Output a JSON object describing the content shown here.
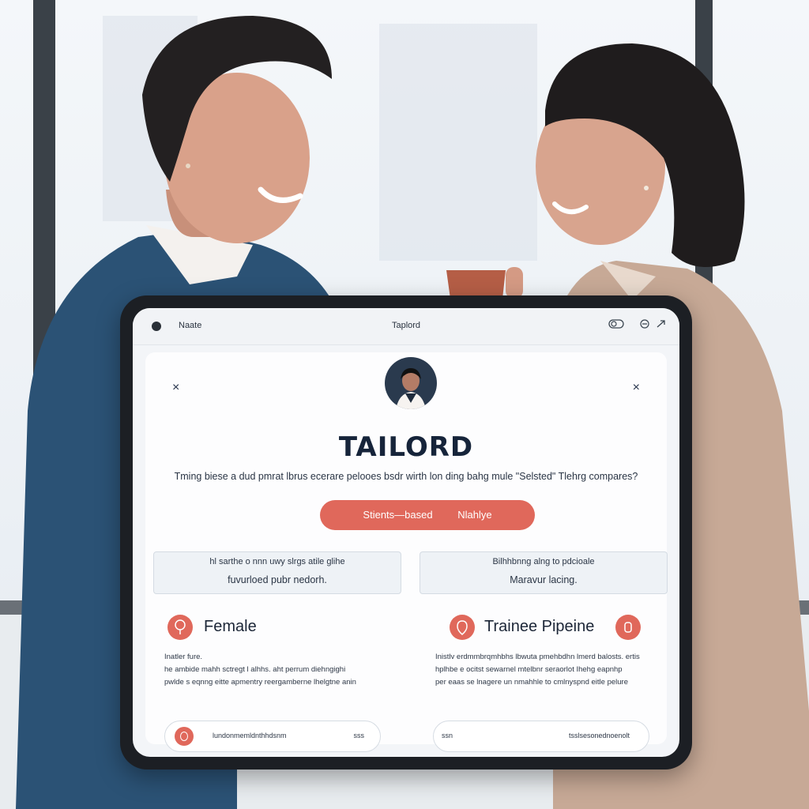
{
  "window": {
    "menu_label": "Naate",
    "title": "Taplord",
    "icons": [
      "toggle-icon",
      "minimize-icon",
      "expand-icon"
    ]
  },
  "card": {
    "close_symbol": "×",
    "brand": "TAILORD",
    "tagline": "Tming biese a dud pmrat lbrus ecerare pelooes bsdr wirth lon ding bahg mule \"Selsted\" Tlehrg compares?",
    "cta": {
      "left": "Stients—based",
      "right": "Nlahlye"
    },
    "info_left": {
      "line1": "hl sarthe o nnn uwy slrgs atile glihe",
      "line2": "fuvurloed pubr nedorh."
    },
    "info_right": {
      "line1": "Bilhhbnng alng to pdcioale",
      "line2": "Maravur lacing."
    },
    "feature_left": {
      "title": "Female",
      "text": [
        "Inatler fure.",
        "he ambide mahh sctregt l alhhs. aht perrum diehngighi",
        "pwlde s eqnng eitte apmentry reergamberne lhelgtne anin"
      ]
    },
    "feature_right": {
      "title": "Trainee Pipeine",
      "text": [
        "Inistlv erdmmbrqmhbhs lbwuta pmehbdhn lmerd balosts. ertis",
        "hplhbe e ocitst sewarnel mtelbnr seraorlot Ihehg eapnhp",
        "per eaas se lnagere un nmahhle to cmlnyspnd eitle pelure"
      ]
    },
    "pill_left": {
      "label": "lundonmemldnthhdsnm",
      "end": "sss"
    },
    "pill_right": {
      "label": "ssn",
      "end": "tsslsesonednoenolt"
    }
  },
  "colors": {
    "accent": "#e0685b",
    "ink": "#16243a",
    "device_bezel": "#1c1f24"
  }
}
